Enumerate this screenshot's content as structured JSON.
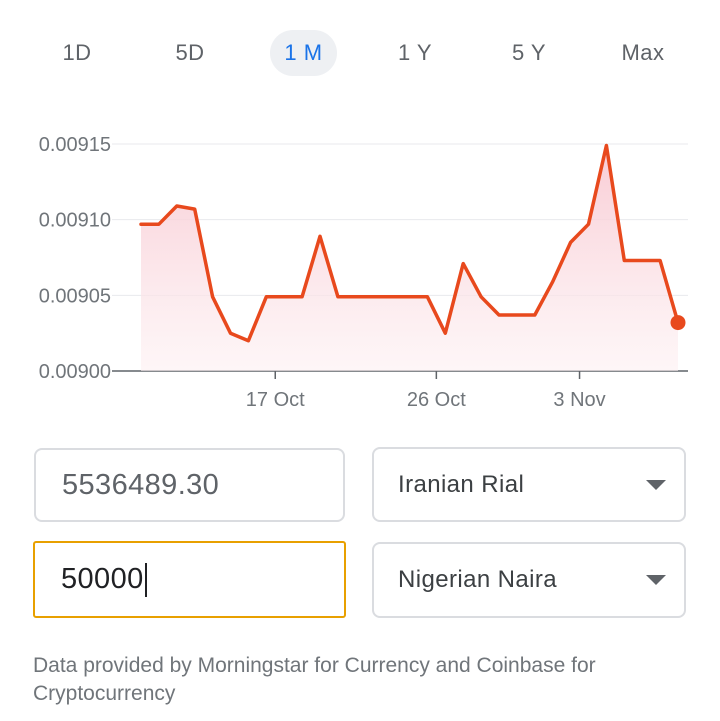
{
  "range_tabs": [
    {
      "label": "1D",
      "selected": false
    },
    {
      "label": "5D",
      "selected": false
    },
    {
      "label": "1 M",
      "selected": true
    },
    {
      "label": "1 Y",
      "selected": false
    },
    {
      "label": "5 Y",
      "selected": false
    },
    {
      "label": "Max",
      "selected": false
    }
  ],
  "converter": {
    "from_amount": "5536489.30",
    "from_currency": "Iranian Rial",
    "to_amount": "50000",
    "to_currency": "Nigerian Naira"
  },
  "footnote": "Data provided by Morningstar for Currency and Coinbase for Cryptocurrency",
  "colors": {
    "line": "#e8491d",
    "accent": "#1a73e8",
    "focus_border": "#e8a000"
  },
  "chart_data": {
    "type": "area",
    "y_ticks": [
      "0.00915",
      "0.00910",
      "0.00905",
      "0.00900"
    ],
    "x_ticks": [
      "17 Oct",
      "26 Oct",
      "3 Nov"
    ],
    "ylim": [
      0.009,
      0.00915
    ],
    "grid": true,
    "series": [
      {
        "values": [
          0.009097,
          0.009097,
          0.009109,
          0.009107,
          0.009049,
          0.009025,
          0.00902,
          0.009049,
          0.009049,
          0.009049,
          0.009089,
          0.009049,
          0.009049,
          0.009049,
          0.009049,
          0.009049,
          0.009049,
          0.009025,
          0.009071,
          0.009049,
          0.009037,
          0.009037,
          0.009037,
          0.009059,
          0.009085,
          0.009097,
          0.009149,
          0.009073,
          0.009073,
          0.009073,
          0.009032
        ]
      }
    ]
  }
}
